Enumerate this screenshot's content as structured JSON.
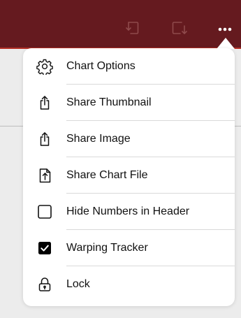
{
  "colors": {
    "header_background": "#651a1f",
    "header_accent_line": "#b53026",
    "menu_background": "#ffffff"
  },
  "header": {
    "icons": [
      "undo-icon",
      "redo-icon",
      "more-icon"
    ]
  },
  "menu": {
    "items": [
      {
        "label": "Chart Options",
        "icon": "gear-icon"
      },
      {
        "label": "Share Thumbnail",
        "icon": "share-icon"
      },
      {
        "label": "Share Image",
        "icon": "share-icon"
      },
      {
        "label": "Share Chart File",
        "icon": "share-file-icon"
      },
      {
        "label": "Hide Numbers in Header",
        "icon": "checkbox-unchecked-icon",
        "checked": false
      },
      {
        "label": "Warping Tracker",
        "icon": "checkbox-checked-icon",
        "checked": true
      },
      {
        "label": "Lock",
        "icon": "lock-icon"
      }
    ]
  }
}
